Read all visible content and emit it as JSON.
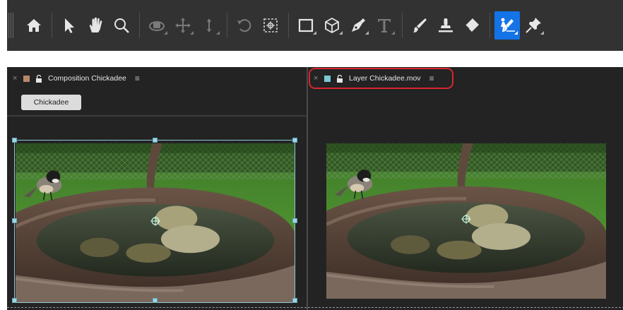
{
  "toolbar": {
    "tools": [
      {
        "id": "home",
        "icon": "home-icon",
        "has_submenu": false,
        "enabled": true
      },
      {
        "sep": true
      },
      {
        "id": "selection",
        "icon": "selection-arrow-icon",
        "has_submenu": false,
        "enabled": true
      },
      {
        "id": "hand",
        "icon": "hand-icon",
        "has_submenu": false,
        "enabled": true
      },
      {
        "id": "zoom",
        "icon": "zoom-magnifier-icon",
        "has_submenu": false,
        "enabled": true
      },
      {
        "sep": true
      },
      {
        "id": "orbit-camera",
        "icon": "orbit-camera-icon",
        "has_submenu": true,
        "enabled": false
      },
      {
        "id": "pan-camera",
        "icon": "pan-camera-icon",
        "has_submenu": true,
        "enabled": false
      },
      {
        "id": "dolly-camera",
        "icon": "dolly-camera-icon",
        "has_submenu": true,
        "enabled": false
      },
      {
        "sep": true
      },
      {
        "id": "rotation",
        "icon": "rotation-icon",
        "has_submenu": false,
        "enabled": false
      },
      {
        "id": "pan-behind",
        "icon": "pan-behind-anchor-icon",
        "has_submenu": false,
        "enabled": true
      },
      {
        "sep": true
      },
      {
        "id": "rectangle",
        "icon": "rectangle-shape-icon",
        "has_submenu": true,
        "enabled": true
      },
      {
        "id": "3d-shape",
        "icon": "cube-icon",
        "has_submenu": true,
        "enabled": true
      },
      {
        "id": "pen",
        "icon": "pen-icon",
        "has_submenu": true,
        "enabled": true
      },
      {
        "id": "type",
        "icon": "type-t-icon",
        "has_submenu": true,
        "enabled": false
      },
      {
        "sep": true
      },
      {
        "id": "brush",
        "icon": "brush-icon",
        "has_submenu": false,
        "enabled": true
      },
      {
        "id": "clone-stamp",
        "icon": "clone-stamp-icon",
        "has_submenu": false,
        "enabled": true
      },
      {
        "id": "eraser",
        "icon": "eraser-icon",
        "has_submenu": false,
        "enabled": true
      },
      {
        "sep": true
      },
      {
        "id": "roto-brush",
        "icon": "roto-brush-icon",
        "has_submenu": true,
        "enabled": true,
        "active": true
      },
      {
        "id": "puppet-pin",
        "icon": "puppet-pin-icon",
        "has_submenu": true,
        "enabled": true
      }
    ]
  },
  "composition_panel": {
    "close": "×",
    "swatch_color": "#b7896b",
    "title": "Composition Chickadee",
    "menu": "≡",
    "flow_button": "Chickadee"
  },
  "layer_panel": {
    "close": "×",
    "swatch_color": "#7cc7d4",
    "title": "Layer Chickadee.mov",
    "menu": "≡",
    "highlight_color": "#d8262f"
  },
  "colors": {
    "toolbar_bg": "#323232",
    "panel_bg": "#232323",
    "active_tool": "#1473e6",
    "bbox_handle": "#9fd6e6"
  }
}
